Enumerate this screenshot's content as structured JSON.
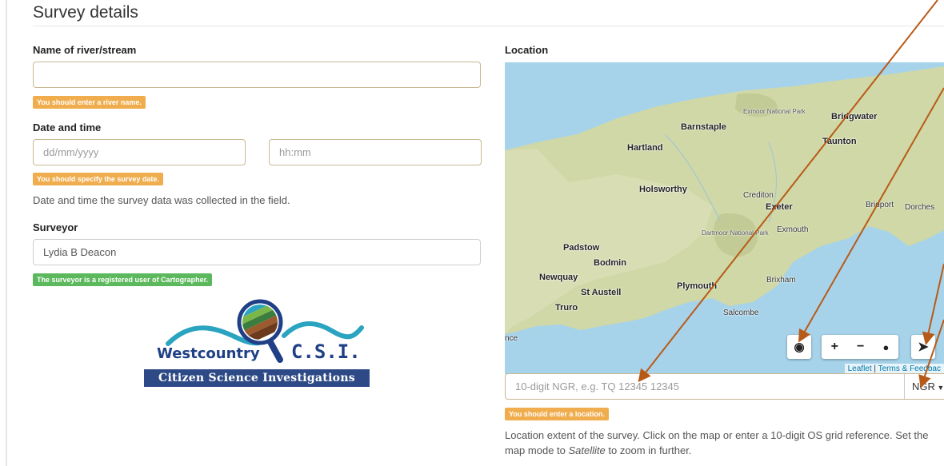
{
  "section": {
    "title": "Survey details"
  },
  "river": {
    "label": "Name of river/stream",
    "value": "",
    "warning": "You should enter a river name."
  },
  "datetime": {
    "label": "Date and time",
    "date_placeholder": "dd/mm/yyyy",
    "time_placeholder": "hh:mm",
    "warning": "You should specify the survey date.",
    "help": "Date and time the survey data was collected in the field."
  },
  "surveyor": {
    "label": "Surveyor",
    "value": "Lydia B Deacon",
    "status": "The surveyor is a registered user of Cartographer."
  },
  "logo": {
    "name": "Westcountry",
    "csi": "C.S.I.",
    "tagline": "Citizen Science Investigations"
  },
  "location": {
    "label": "Location",
    "map": {
      "places": [
        {
          "name": "Barnstaple"
        },
        {
          "name": "Bridgwater"
        },
        {
          "name": "Taunton"
        },
        {
          "name": "Hartland"
        },
        {
          "name": "Holsworthy"
        },
        {
          "name": "Crediton"
        },
        {
          "name": "Exeter"
        },
        {
          "name": "Bridport"
        },
        {
          "name": "Dorches"
        },
        {
          "name": "Exmouth"
        },
        {
          "name": "Padstow"
        },
        {
          "name": "Bodmin"
        },
        {
          "name": "Newquay"
        },
        {
          "name": "Plymouth"
        },
        {
          "name": "Brixham"
        },
        {
          "name": "St Austell"
        },
        {
          "name": "Truro"
        },
        {
          "name": "Salcombe"
        },
        {
          "name": "nce"
        }
      ],
      "parks": [
        "Exmoor National Park",
        "Dartmoor National Park"
      ],
      "controls": {
        "layers": "globe-icon",
        "zoom_in": "+",
        "zoom_out": "−",
        "marker": "marker-icon",
        "locate": "locate-arrow-icon"
      },
      "attribution": {
        "leaflet": "Leaflet",
        "sep": " | ",
        "terms": "Terms & Feedbac"
      }
    },
    "ngr_placeholder": "10-digit NGR, e.g. TQ 12345 12345",
    "ngr_mode": "NGR",
    "warning": "You should enter a location.",
    "help_pre": "Location extent of the survey. Click on the map or enter a 10-digit OS grid reference. Set the map mode to ",
    "help_em": "Satellite",
    "help_post": " to zoom in further."
  },
  "colors": {
    "warning": "#f0ad4e",
    "success": "#5cb85c",
    "arrow": "#b85a17",
    "sea": "#a7d3ea",
    "land": "#cfd8a6"
  }
}
